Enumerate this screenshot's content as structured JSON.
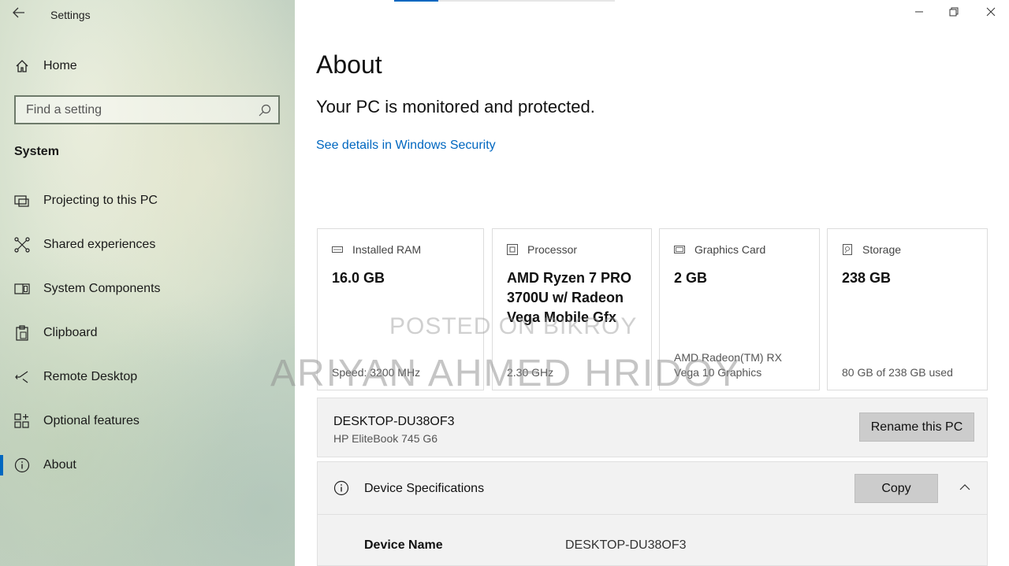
{
  "window": {
    "title": "Settings",
    "controls": {
      "minimize": "minimize-icon",
      "restore": "restore-icon",
      "close": "close-icon"
    }
  },
  "sidebar": {
    "home_label": "Home",
    "search_placeholder": "Find a setting",
    "section_title": "System",
    "items": [
      {
        "label": "Projecting to this PC",
        "icon": "projector-icon"
      },
      {
        "label": "Shared experiences",
        "icon": "share-icon"
      },
      {
        "label": "System Components",
        "icon": "components-icon"
      },
      {
        "label": "Clipboard",
        "icon": "clipboard-icon"
      },
      {
        "label": "Remote Desktop",
        "icon": "remote-desktop-icon"
      },
      {
        "label": "Optional features",
        "icon": "grid-plus-icon"
      },
      {
        "label": "About",
        "icon": "info-icon",
        "active": true
      }
    ]
  },
  "main": {
    "title": "About",
    "status": "Your PC is monitored and protected.",
    "security_link": "See details in Windows Security",
    "cards": [
      {
        "header": "Installed RAM",
        "value": "16.0 GB",
        "sub": "Speed: 3200 MHz",
        "icon": "ram-icon"
      },
      {
        "header": "Processor",
        "value": "AMD Ryzen 7 PRO 3700U w/ Radeon Vega Mobile Gfx",
        "sub": "2.30 GHz",
        "icon": "processor-icon"
      },
      {
        "header": "Graphics Card",
        "value": "2 GB",
        "sub": "AMD Radeon(TM) RX Vega 10 Graphics",
        "icon": "graphics-card-icon"
      },
      {
        "header": "Storage",
        "value": "238 GB",
        "sub": "80 GB of 238 GB used",
        "icon": "storage-icon"
      }
    ],
    "pc": {
      "name": "DESKTOP-DU38OF3",
      "model": "HP EliteBook 745 G6",
      "rename_label": "Rename this PC"
    },
    "specs": {
      "title": "Device Specifications",
      "copy_label": "Copy",
      "rows": [
        {
          "key": "Device Name",
          "value": "DESKTOP-DU38OF3"
        }
      ]
    }
  },
  "watermark": {
    "line1": "POSTED ON BIKROY",
    "line2": "ARIYAN AHMED HRIDOY"
  },
  "colors": {
    "accent": "#0067c0",
    "button": "#cccccc",
    "panel": "#f2f2f2"
  }
}
